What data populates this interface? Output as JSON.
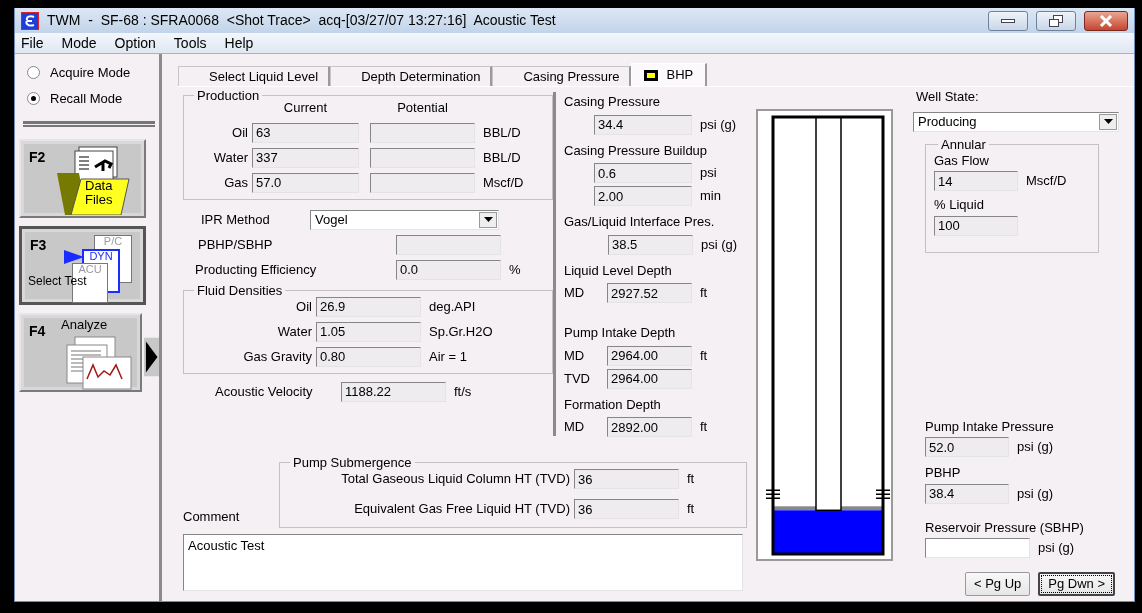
{
  "window": {
    "title": "TWM  -  SF-68 : SFRA0068  <Shot Trace>  acq-[03/27/07 13:27:16]  Acoustic Test"
  },
  "menu": [
    {
      "label": "File"
    },
    {
      "label": "Mode"
    },
    {
      "label": "Option"
    },
    {
      "label": "Tools"
    },
    {
      "label": "Help"
    }
  ],
  "modes": [
    {
      "label": "Acquire Mode",
      "selected": false
    },
    {
      "label": "Recall Mode",
      "selected": true
    }
  ],
  "function_keys": [
    {
      "key": "F2",
      "kind": "files",
      "label": "Data Files",
      "selected": false
    },
    {
      "key": "F3",
      "kind": "select",
      "label": "Select Test",
      "icon_labels": [
        "P/C",
        "DYN",
        "ACU"
      ],
      "selected": true
    },
    {
      "key": "F4",
      "kind": "analyze",
      "label": "Analyze",
      "selected": false
    }
  ],
  "tabs": [
    {
      "label": "Select Liquid Level",
      "selected": false,
      "flagged": false
    },
    {
      "label": "Depth Determination",
      "selected": false,
      "flagged": false
    },
    {
      "label": "Casing Pressure",
      "selected": false,
      "flagged": false
    },
    {
      "label": "BHP",
      "selected": true,
      "flagged": true
    }
  ],
  "production": {
    "title": "Production",
    "columns": [
      "Current",
      "Potential"
    ],
    "rows": [
      {
        "label": "Oil",
        "current": "63",
        "unit": "BBL/D"
      },
      {
        "label": "Water",
        "current": "337",
        "unit": "BBL/D"
      },
      {
        "label": "Gas",
        "current": "57.0",
        "unit": "Mscf/D"
      }
    ]
  },
  "ipr_method": {
    "label": "IPR Method",
    "value": "Vogel"
  },
  "pbhp_sbhp": {
    "label": "PBHP/SBHP"
  },
  "producing_efficiency": {
    "label": "Producting Efficiency",
    "value": "0.0",
    "unit": "%"
  },
  "fluid_densities": {
    "title": "Fluid Densities",
    "rows": [
      {
        "label": "Oil",
        "value": "26.9",
        "unit": "deg.API"
      },
      {
        "label": "Water",
        "value": "1.05",
        "unit": "Sp.Gr.H2O"
      },
      {
        "label": "Gas Gravity",
        "value": "0.80",
        "unit": "Air = 1"
      }
    ]
  },
  "acoustic_velocity": {
    "label": "Acoustic Velocity",
    "value": "1188.22",
    "unit": "ft/s"
  },
  "depths": [
    {
      "title": "Casing Pressure",
      "rows": [
        {
          "value": "34.4",
          "unit": "psi (g)"
        }
      ]
    },
    {
      "title": "Casing Pressure Buildup",
      "rows": [
        {
          "value": "0.6",
          "unit": "psi"
        },
        {
          "value": "2.00",
          "unit": "min"
        }
      ]
    },
    {
      "title": "Gas/Liquid Interface Pres.",
      "rows": [
        {
          "value": "38.5",
          "unit": "psi (g)"
        }
      ]
    },
    {
      "title": "Liquid Level Depth",
      "rows": [
        {
          "prefix": "MD",
          "value": "2927.52",
          "unit": "ft"
        }
      ]
    },
    {
      "title": "Pump Intake Depth",
      "rows": [
        {
          "prefix": "MD",
          "value": "2964.00",
          "unit": "ft"
        },
        {
          "prefix": "TVD",
          "value": "2964.00"
        }
      ]
    },
    {
      "title": "Formation Depth",
      "rows": [
        {
          "prefix": "MD",
          "value": "2892.00",
          "unit": "ft"
        }
      ]
    }
  ],
  "pump_submergence": {
    "title": "Pump Submergence",
    "rows": [
      {
        "label": "Total Gaseous Liquid Column HT (TVD)",
        "value": "36",
        "unit": "ft"
      },
      {
        "label": "Equivalent Gas Free Liquid HT (TVD)",
        "value": "36",
        "unit": "ft"
      }
    ]
  },
  "comment": {
    "label": "Comment",
    "value": "Acoustic Test"
  },
  "well_diagram": {
    "level": 0.1
  },
  "well_state": {
    "label": "Well State:",
    "value": "Producing"
  },
  "annular": {
    "title": "Annular",
    "rows": [
      {
        "label": "Gas Flow",
        "value": "14",
        "unit": "Mscf/D"
      },
      {
        "label": "% Liquid",
        "value": "100"
      }
    ]
  },
  "pressures": [
    {
      "label": "Pump Intake Pressure",
      "value": "52.0",
      "unit": "psi (g)",
      "editable": false
    },
    {
      "label": "PBHP",
      "value": "38.4",
      "unit": "psi (g)",
      "editable": false
    },
    {
      "label": "Reservoir Pressure (SBHP)",
      "unit": "psi (g)",
      "editable": true
    }
  ],
  "buttons": [
    {
      "label": "< Pg Up",
      "focused": false
    },
    {
      "label": "Pg Dwn >",
      "focused": true
    }
  ]
}
